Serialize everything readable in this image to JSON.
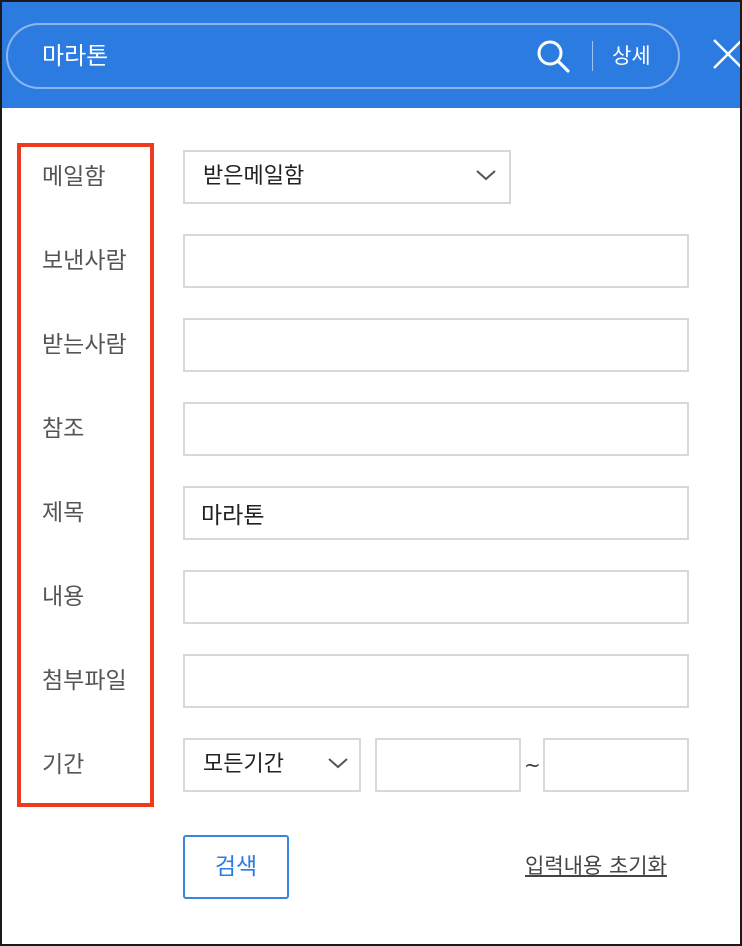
{
  "header": {
    "search_value": "마라톤",
    "detail_label": "상세"
  },
  "form": {
    "mailbox": {
      "label": "메일함",
      "selected": "받은메일함"
    },
    "sender": {
      "label": "보낸사람",
      "value": ""
    },
    "recipient": {
      "label": "받는사람",
      "value": ""
    },
    "cc": {
      "label": "참조",
      "value": ""
    },
    "subject": {
      "label": "제목",
      "value": "마라톤"
    },
    "body": {
      "label": "내용",
      "value": ""
    },
    "attachment": {
      "label": "첨부파일",
      "value": ""
    },
    "period": {
      "label": "기간",
      "selected": "모든기간",
      "start": "",
      "end": "",
      "separator": "~"
    }
  },
  "actions": {
    "search_label": "검색",
    "reset_label": "입력내용 초기화"
  },
  "colors": {
    "header_bg": "#2c7be0",
    "highlight_border": "#f03a1e",
    "button_accent": "#2c7be0"
  },
  "icons": [
    "search-icon",
    "close-icon",
    "chevron-down-icon"
  ]
}
